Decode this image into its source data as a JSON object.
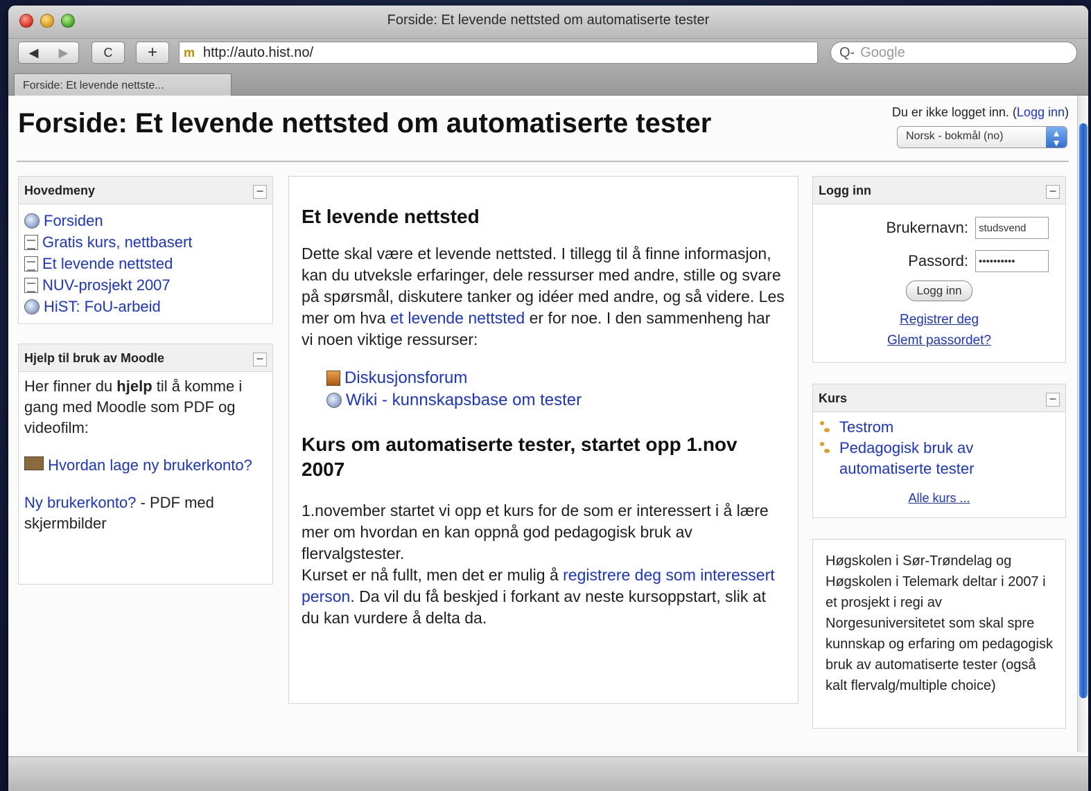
{
  "window": {
    "title": "Forside: Et levende nettsted om automatiserte tester"
  },
  "toolbar": {
    "back_glyph": "◀",
    "forward_glyph": "▶",
    "reload_glyph": "C",
    "newtab_glyph": "+",
    "favicon_glyph": "m",
    "url": "http://auto.hist.no/",
    "search_prefix": "Q-",
    "search_placeholder": "Google"
  },
  "tab": {
    "label": "Forside: Et levende nettste..."
  },
  "page": {
    "title": "Forside: Et levende nettsted om automatiserte tester",
    "login_status_prefix": "Du er ikke logget inn. (",
    "login_link": "Logg inn",
    "login_status_suffix": ")",
    "language": "Norsk - bokmål (no)"
  },
  "main_menu": {
    "heading": "Hovedmeny",
    "items": [
      {
        "label": "Forsiden",
        "icon": "globe-icon"
      },
      {
        "label": "Gratis kurs, nettbasert",
        "icon": "page-icon"
      },
      {
        "label": "Et levende nettsted",
        "icon": "page-icon"
      },
      {
        "label": "NUV-prosjekt 2007",
        "icon": "page-icon"
      },
      {
        "label": "HiST: FoU-arbeid",
        "icon": "globe-icon"
      }
    ]
  },
  "help_block": {
    "heading": "Hjelp til bruk av Moodle",
    "intro_a": "Her finner du ",
    "intro_bold": "hjelp",
    "intro_b": " til å komme i gang med Moodle som PDF og videofilm:",
    "video_link": "Hvordan lage ny brukerkonto?",
    "pdf_link": "Ny brukerkonto?",
    "pdf_suffix": " - PDF med skjermbilder"
  },
  "center": {
    "heading1": "Et levende nettsted",
    "para1_a": "Dette skal være et levende nettsted. I tillegg til å finne informasjon, kan du utveksle erfaringer, dele ressurser med andre, stille og svare på spørsmål, diskutere tanker og idéer med andre, og så videre. Les mer om hva ",
    "para1_link": "et levende nettsted",
    "para1_b": " er for noe. I den sammenheng har vi noen viktige ressurser:",
    "resources": [
      {
        "label": "Diskusjonsforum",
        "icon": "forum-icon"
      },
      {
        "label": "Wiki - kunnskapsbase om tester",
        "icon": "wiki-icon"
      }
    ],
    "heading2": "Kurs om automatiserte tester, startet opp 1.nov 2007",
    "para2_a": "1.november startet vi opp et kurs for de som er interessert i å lære mer om hvordan en kan oppnå god pedagogisk bruk av flervalgstester.",
    "para2_b": "Kurset er nå fullt, men det er mulig å ",
    "para2_link": "registrere deg som interessert person",
    "para2_c": ". Da vil du få beskjed i forkant av neste kursoppstart, slik at du kan vurdere å delta da."
  },
  "login_block": {
    "heading": "Logg inn",
    "username_label": "Brukernavn:",
    "username_value": "studsvend",
    "password_label": "Passord:",
    "password_value": "••••••••••",
    "button": "Logg inn",
    "register_link": "Registrer deg",
    "forgot_link": "Glemt passordet?"
  },
  "courses_block": {
    "heading": "Kurs",
    "items": [
      {
        "label": "Testrom"
      },
      {
        "label": "Pedagogisk bruk av automatiserte tester"
      }
    ],
    "all_link": "Alle kurs ..."
  },
  "info_block": {
    "text": "Høgskolen i Sør-Trøndelag og Høgskolen i Telemark deltar i 2007 i et prosjekt i regi av Norgesuniversitetet som skal spre kunnskap og erfaring om pedagogisk bruk av automatiserte tester (også kalt flervalg/multiple choice)"
  },
  "colors": {
    "link": "#1a33d6",
    "scrollbar": "#1f5fcc"
  }
}
